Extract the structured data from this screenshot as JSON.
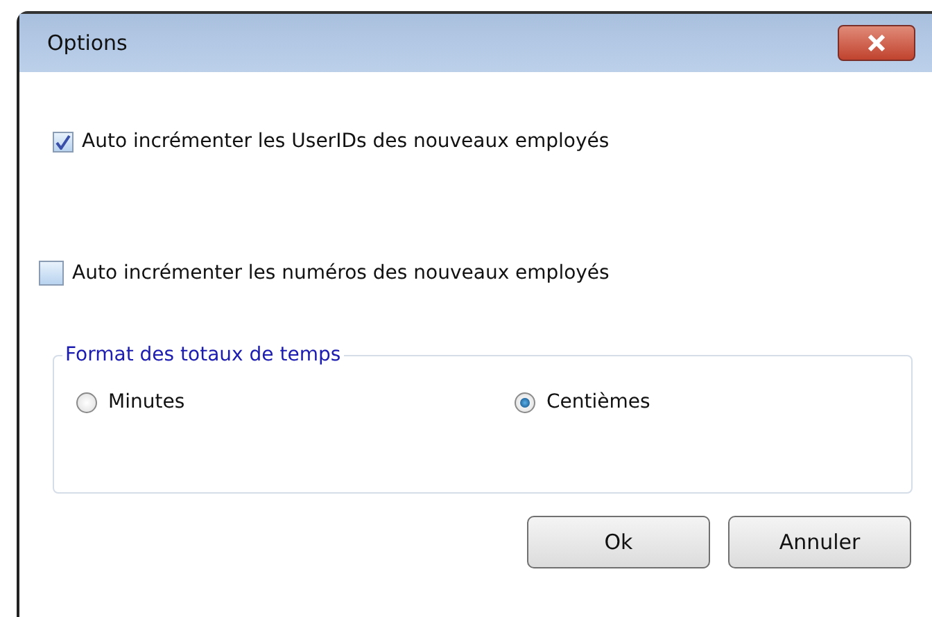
{
  "window": {
    "title": "Options"
  },
  "checkboxes": [
    {
      "label": "Auto incrémenter les UserIDs des nouveaux employés",
      "checked": true
    },
    {
      "label": "Auto incrémenter les numéros des nouveaux employés",
      "checked": false
    }
  ],
  "group": {
    "title": "Format des totaux de temps",
    "options": [
      {
        "label": "Minutes",
        "selected": false
      },
      {
        "label": "Centièmes",
        "selected": true
      }
    ]
  },
  "buttons": [
    "Ok",
    "Annuler"
  ]
}
